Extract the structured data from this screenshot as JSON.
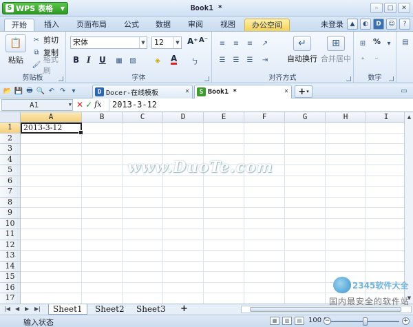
{
  "titlebar": {
    "app_name": "WPS 表格",
    "doc_title": "Book1 *",
    "min_glyph": "–",
    "max_glyph": "□",
    "close_glyph": "✕"
  },
  "ribbon_tabs": [
    {
      "label": "开始",
      "active": true
    },
    {
      "label": "插入"
    },
    {
      "label": "页面布局"
    },
    {
      "label": "公式"
    },
    {
      "label": "数据"
    },
    {
      "label": "审阅"
    },
    {
      "label": "视图"
    },
    {
      "label": "办公空间",
      "special": true
    }
  ],
  "right_tools": {
    "login": "未登录",
    "help_glyph": "?"
  },
  "clipboard": {
    "paste": "粘贴",
    "cut": "剪切",
    "copy": "复制",
    "format_painter": "格式刷",
    "group_label": "剪贴板"
  },
  "font": {
    "name": "宋体",
    "size": "12",
    "bold": "B",
    "italic": "I",
    "underline": "U",
    "group_label": "字体"
  },
  "alignment": {
    "wrap": "自动换行",
    "merge": "合并居中",
    "group_label": "对齐方式"
  },
  "number": {
    "percent": "%",
    "group_label": "数字"
  },
  "doc_tabs": [
    {
      "label": "Docer-在线模板",
      "icon": "D",
      "color": "#2e65b1"
    },
    {
      "label": "Book1 *",
      "icon": "S",
      "color": "#3e9b2e",
      "active": true
    }
  ],
  "formula_bar": {
    "name_box": "A1",
    "cancel": "✕",
    "confirm": "✓",
    "fx": "fx",
    "content": "2013-3-12"
  },
  "grid": {
    "columns": [
      "A",
      "B",
      "C",
      "D",
      "E",
      "F",
      "G",
      "H",
      "I"
    ],
    "rows": [
      "1",
      "2",
      "3",
      "4",
      "5",
      "6",
      "7",
      "8",
      "9",
      "10",
      "11",
      "12",
      "13",
      "14",
      "15",
      "16",
      "17"
    ],
    "cell_a1": "2013-3-12",
    "watermark": "www.DuoTe.com"
  },
  "sheets": [
    {
      "label": "Sheet1",
      "active": true
    },
    {
      "label": "Sheet2"
    },
    {
      "label": "Sheet3"
    }
  ],
  "status": {
    "mode": "输入状态",
    "zoom": "100 %"
  },
  "brand": {
    "line1": "2345软件大全",
    "line2": "国内最安全的软件站"
  }
}
